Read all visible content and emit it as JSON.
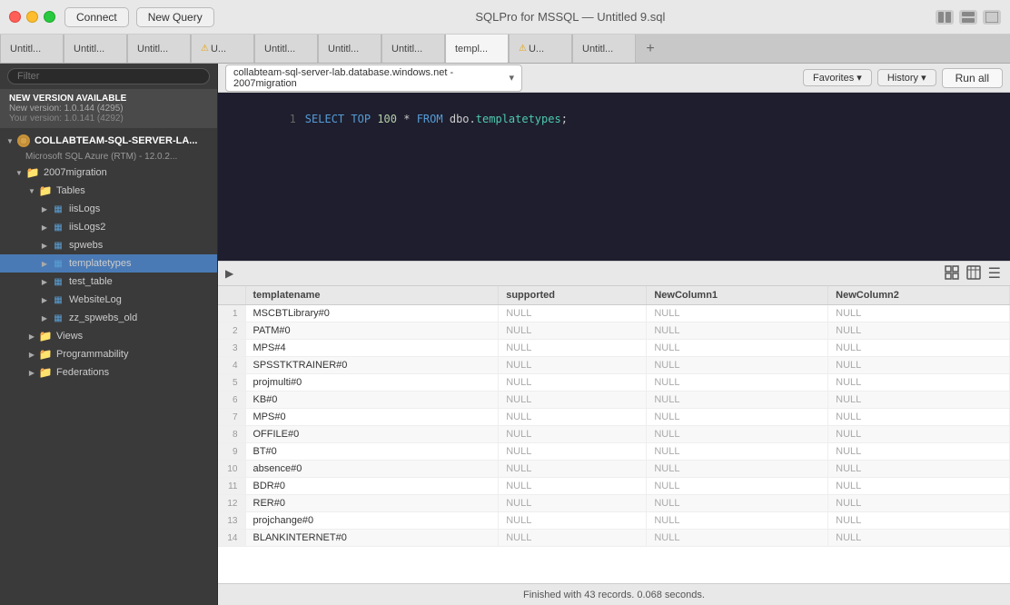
{
  "titleBar": {
    "connectLabel": "Connect",
    "newQueryLabel": "New Query",
    "title": "SQLPro for MSSQL — Untitled 9.sql"
  },
  "tabs": [
    {
      "label": "Untitl...",
      "active": false,
      "warning": false
    },
    {
      "label": "Untitl...",
      "active": false,
      "warning": false
    },
    {
      "label": "Untitl...",
      "active": false,
      "warning": false
    },
    {
      "label": "⚠ U...",
      "active": false,
      "warning": true
    },
    {
      "label": "Untitl...",
      "active": false,
      "warning": false
    },
    {
      "label": "Untitl...",
      "active": false,
      "warning": false
    },
    {
      "label": "Untitl...",
      "active": false,
      "warning": false
    },
    {
      "label": "templ...",
      "active": true,
      "warning": false
    },
    {
      "label": "⚠ U...",
      "active": false,
      "warning": true
    },
    {
      "label": "Untitl...",
      "active": false,
      "warning": false
    }
  ],
  "sidebar": {
    "searchPlaceholder": "Filter",
    "updateBanner": {
      "title": "NEW VERSION AVAILABLE",
      "newVersion": "New version:  1.0.144 (4295)",
      "yourVersion": "Your version:  1.0.141 (4292)"
    },
    "server": {
      "name": "COLLABTEAM-SQL-SERVER-LA...",
      "subtitle": "Microsoft SQL Azure (RTM) - 12.0.2...",
      "databases": [
        {
          "name": "2007migration",
          "groups": [
            {
              "name": "Tables",
              "items": [
                "iisLogs",
                "iisLogs2",
                "spwebs",
                "templatetypes",
                "test_table",
                "WebsiteLog",
                "zz_spwebs_old"
              ]
            }
          ]
        }
      ],
      "rootGroups": [
        "Views",
        "Programmability",
        "Federations"
      ]
    }
  },
  "queryToolbar": {
    "dbSelector": "collabteam-sql-server-lab.database.windows.net - 2007migration",
    "favoritesLabel": "Favorites ▾",
    "historyLabel": "History ▾",
    "runAllLabel": "Run all"
  },
  "editor": {
    "lineNumber": "1",
    "code": "SELECT TOP 100 * FROM dbo.templatetypes;"
  },
  "resultsTable": {
    "columns": [
      "templatename",
      "supported",
      "NewColumn1",
      "NewColumn2"
    ],
    "rows": [
      {
        "num": 1,
        "templatename": "MSCBTLibrary#0",
        "supported": "NULL",
        "NewColumn1": "NULL",
        "NewColumn2": "NULL"
      },
      {
        "num": 2,
        "templatename": "PATM#0",
        "supported": "NULL",
        "NewColumn1": "NULL",
        "NewColumn2": "NULL"
      },
      {
        "num": 3,
        "templatename": "MPS#4",
        "supported": "NULL",
        "NewColumn1": "NULL",
        "NewColumn2": "NULL"
      },
      {
        "num": 4,
        "templatename": "SPSSTKTRAINER#0",
        "supported": "NULL",
        "NewColumn1": "NULL",
        "NewColumn2": "NULL"
      },
      {
        "num": 5,
        "templatename": "projmulti#0",
        "supported": "NULL",
        "NewColumn1": "NULL",
        "NewColumn2": "NULL"
      },
      {
        "num": 6,
        "templatename": "KB#0",
        "supported": "NULL",
        "NewColumn1": "NULL",
        "NewColumn2": "NULL"
      },
      {
        "num": 7,
        "templatename": "MPS#0",
        "supported": "NULL",
        "NewColumn1": "NULL",
        "NewColumn2": "NULL"
      },
      {
        "num": 8,
        "templatename": "OFFILE#0",
        "supported": "NULL",
        "NewColumn1": "NULL",
        "NewColumn2": "NULL"
      },
      {
        "num": 9,
        "templatename": "BT#0",
        "supported": "NULL",
        "NewColumn1": "NULL",
        "NewColumn2": "NULL"
      },
      {
        "num": 10,
        "templatename": "absence#0",
        "supported": "NULL",
        "NewColumn1": "NULL",
        "NewColumn2": "NULL"
      },
      {
        "num": 11,
        "templatename": "BDR#0",
        "supported": "NULL",
        "NewColumn1": "NULL",
        "NewColumn2": "NULL"
      },
      {
        "num": 12,
        "templatename": "RER#0",
        "supported": "NULL",
        "NewColumn1": "NULL",
        "NewColumn2": "NULL"
      },
      {
        "num": 13,
        "templatename": "projchange#0",
        "supported": "NULL",
        "NewColumn1": "NULL",
        "NewColumn2": "NULL"
      },
      {
        "num": 14,
        "templatename": "BLANKINTERNET#0",
        "supported": "NULL",
        "NewColumn1": "NULL",
        "NewColumn2": "NULL"
      }
    ]
  },
  "statusBar": {
    "message": "Finished with 43 records. 0.068 seconds."
  }
}
